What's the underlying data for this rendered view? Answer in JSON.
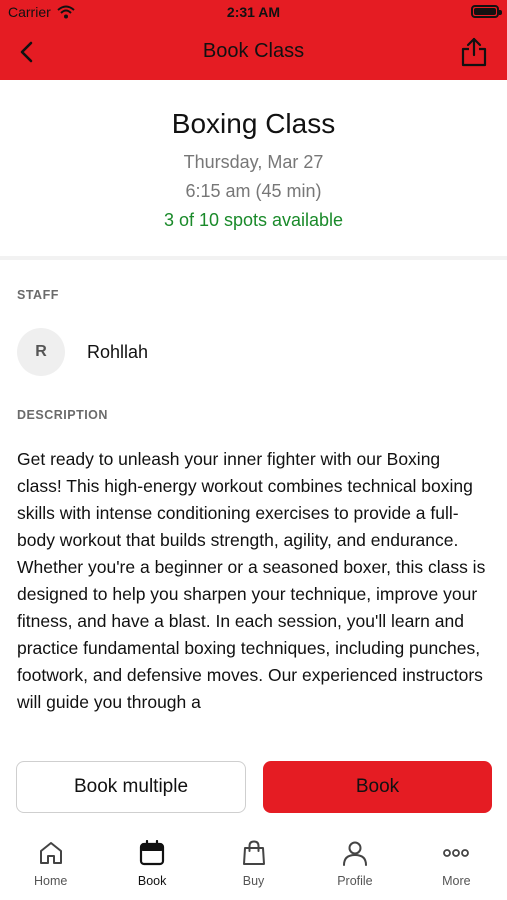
{
  "status_bar": {
    "carrier": "Carrier",
    "time": "2:31 AM"
  },
  "navbar": {
    "title": "Book Class"
  },
  "class": {
    "name": "Boxing Class",
    "date": "Thursday, Mar 27",
    "time": "6:15 am (45 min)",
    "spots": "3 of 10 spots available"
  },
  "staff": {
    "label": "STAFF",
    "initial": "R",
    "name": "Rohllah"
  },
  "description": {
    "label": "DESCRIPTION",
    "text": "Get ready to unleash your inner fighter with our Boxing class! This high-energy workout combines technical boxing skills with intense conditioning exercises to provide a full-body workout that builds strength, agility, and endurance. Whether you're a beginner or a seasoned boxer, this class is designed to help you sharpen your technique, improve your fitness, and have a blast. In each session, you'll learn and practice fundamental boxing techniques, including punches, footwork, and defensive moves. Our experienced instructors will guide you through a"
  },
  "actions": {
    "book_multiple": "Book multiple",
    "book": "Book"
  },
  "tabs": [
    {
      "label": "Home",
      "icon": "home-icon"
    },
    {
      "label": "Book",
      "icon": "calendar-icon"
    },
    {
      "label": "Buy",
      "icon": "shopping-bag-icon"
    },
    {
      "label": "Profile",
      "icon": "person-icon"
    },
    {
      "label": "More",
      "icon": "more-dots-icon"
    }
  ],
  "colors": {
    "brand": "#e51c23",
    "available": "#1a8a2a"
  }
}
